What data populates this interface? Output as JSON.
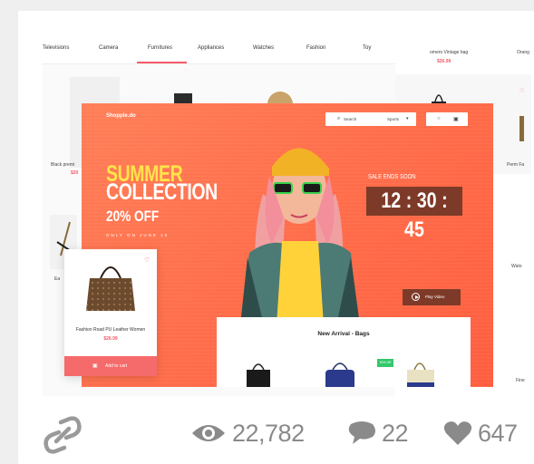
{
  "tabs": [
    "Televisions",
    "Camera",
    "Furnitures",
    "Appliances",
    "Watches",
    "Fashion",
    "Toy"
  ],
  "active_tab": "Furnitures",
  "background_products": [
    {
      "name": "Black premi",
      "price": "$20"
    },
    {
      "name": "Ea",
      "price": ""
    }
  ],
  "right_page": {
    "top_name": "omero Vintage bag",
    "top_price": "$26.99",
    "top_name2": "Orang",
    "side_name": "Perm Fa",
    "side_name2": "Wato",
    "side_name3": "Fine"
  },
  "hero": {
    "logo": "Shopple.do",
    "search_label": "Search",
    "search_category": "Sports",
    "headline_1": "SUMMER",
    "headline_2": "COLLECTION",
    "discount": "20% OFF",
    "only_on": "ONLY ON JUNE 16",
    "sale_ends": "SALE ENDS SOON",
    "timer": "12 : 30 : 45",
    "play_video": "Play Video"
  },
  "new_arrival": {
    "title": "New Arrival - Bags",
    "badge": "50% Off"
  },
  "product_card": {
    "name": "Fashion Road PU Leather Women",
    "price": "$26.99",
    "add_to_cart": "Add to cart"
  },
  "stats": {
    "views": "22,782",
    "comments": "22",
    "likes": "647"
  },
  "colors": {
    "accent": "#f45b69",
    "hero_orange": "#ff6f4c",
    "timer_bg": "#7d3a28",
    "summer_yellow": "#ffe44a",
    "stat_gray": "#8a8a8a"
  }
}
